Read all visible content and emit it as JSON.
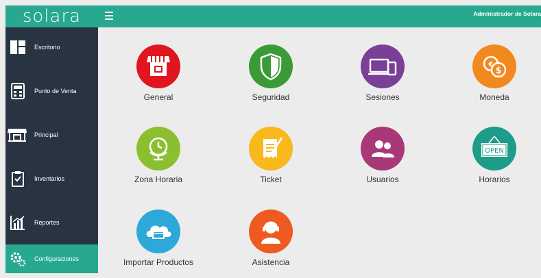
{
  "header": {
    "logo": "solara",
    "user": "Administrador de Solara"
  },
  "sidebar": {
    "items": [
      {
        "label": "Escritorio",
        "icon": "desktop-icon"
      },
      {
        "label": "Punto de Venta",
        "icon": "calculator-icon"
      },
      {
        "label": "Principal",
        "icon": "store-icon"
      },
      {
        "label": "Inventarios",
        "icon": "clipboard-check-icon"
      },
      {
        "label": "Reportes",
        "icon": "bar-chart-icon"
      },
      {
        "label": "Configuraciones",
        "icon": "gears-icon",
        "active": true
      }
    ]
  },
  "tiles": [
    {
      "label": "General",
      "icon": "store-icon",
      "color": "#e0151f"
    },
    {
      "label": "Seguridad",
      "icon": "shield-icon",
      "color": "#3a9a35"
    },
    {
      "label": "Sesiones",
      "icon": "devices-icon",
      "color": "#7a3f96"
    },
    {
      "label": "Moneda",
      "icon": "currency-exchange-icon",
      "color": "#f2891f"
    },
    {
      "label": "Zona Horaria",
      "icon": "globe-clock-icon",
      "color": "#8cbf2f"
    },
    {
      "label": "Ticket",
      "icon": "ticket-icon",
      "color": "#f9b81c"
    },
    {
      "label": "Usuarios",
      "icon": "users-icon",
      "color": "#a83878"
    },
    {
      "label": "Horarios",
      "icon": "open-sign-icon",
      "color": "#1d9c8a"
    },
    {
      "label": "Importar Productos",
      "icon": "cloud-box-icon",
      "color": "#2ea8d8"
    },
    {
      "label": "Asistencia",
      "icon": "support-agent-icon",
      "color": "#ee5a1f"
    }
  ],
  "colors": {
    "accent": "#27a88f",
    "sidebar": "#283442",
    "background": "#ececec"
  }
}
